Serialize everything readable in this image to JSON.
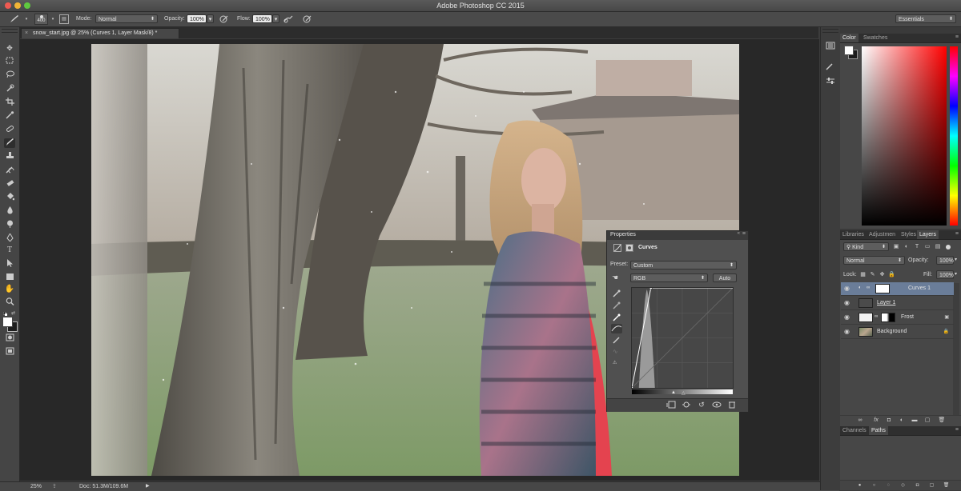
{
  "app": {
    "title": "Adobe Photoshop CC 2015",
    "window_dots": [
      "#ee5a52",
      "#f2b536",
      "#5fc83f"
    ]
  },
  "options_bar": {
    "brush_size": "400",
    "mode_label": "Mode:",
    "mode_value": "Normal",
    "opacity_label": "Opacity:",
    "opacity_value": "100%",
    "flow_label": "Flow:",
    "flow_value": "100%",
    "workspace": "Essentials"
  },
  "document": {
    "tab_close": "×",
    "tab_title": "snow_start.jpg @ 25% (Curves 1, Layer Mask/8) *"
  },
  "toolbar": {
    "tools": [
      "move-icon",
      "marquee-icon",
      "lasso-icon",
      "quick-select-icon",
      "crop-icon",
      "eyedropper-icon",
      "healing-icon",
      "brush-icon",
      "clone-stamp-icon",
      "history-brush-icon",
      "eraser-icon",
      "paint-bucket-icon",
      "blur-icon",
      "dodge-icon",
      "pen-icon",
      "type-icon",
      "path-select-icon",
      "rectangle-icon",
      "hand-icon",
      "zoom-icon"
    ]
  },
  "status_bar": {
    "zoom": "25%",
    "doc": "Doc: 51.3M/109.6M"
  },
  "color_panel": {
    "tabs": [
      "Color",
      "Swatches"
    ],
    "active_tab": "Color",
    "base_hue": "#ff0000"
  },
  "layers_panel": {
    "tabs": [
      "Libraries",
      "Adjustmen",
      "Styles",
      "Layers"
    ],
    "active_tab": "Layers",
    "filter_kind": "Kind",
    "blend_mode": "Normal",
    "opacity_label": "Opacity:",
    "opacity_value": "100%",
    "lock_label": "Lock:",
    "fill_label": "Fill:",
    "fill_value": "100%",
    "layers": [
      {
        "name": "Curves 1",
        "selected": true,
        "type": "adjustment"
      },
      {
        "name": "Layer 1",
        "selected": false,
        "type": "pixel"
      },
      {
        "name": "Frost",
        "selected": false,
        "type": "masked"
      },
      {
        "name": "Background",
        "selected": false,
        "type": "background",
        "locked": true
      }
    ]
  },
  "channels_panel": {
    "tabs": [
      "Channels",
      "Paths"
    ],
    "active_tab": "Paths"
  },
  "properties_panel": {
    "title": "Properties",
    "adjustment": "Curves",
    "preset_label": "Preset:",
    "preset_value": "Custom",
    "channel": "RGB",
    "auto_label": "Auto",
    "curve_points": [
      [
        0,
        0
      ],
      [
        48,
        255
      ]
    ],
    "histogram_peak_input": 38
  }
}
